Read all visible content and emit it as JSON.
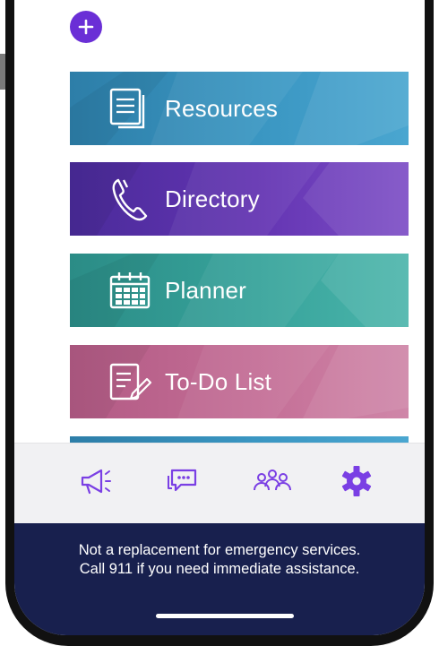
{
  "add_button": {
    "icon": "plus-icon",
    "color": "#6a2fd6"
  },
  "tiles": [
    {
      "label": "Resources",
      "icon": "documents-icon",
      "color": "#3a96c2"
    },
    {
      "label": "Directory",
      "icon": "phone-icon",
      "color": "#6334b2"
    },
    {
      "label": "Planner",
      "icon": "calendar-icon",
      "color": "#37a39b"
    },
    {
      "label": "To-Do List",
      "icon": "checklist-icon",
      "color": "#c46e96"
    }
  ],
  "tabbar": {
    "accent": "#7a3fe4",
    "tabs": [
      {
        "icon": "megaphone-icon"
      },
      {
        "icon": "chat-icon"
      },
      {
        "icon": "people-icon"
      },
      {
        "icon": "gear-icon",
        "active": true
      }
    ]
  },
  "footer": {
    "line1": "Not a replacement for emergency services.",
    "line2": "Call 911 if you need immediate assistance.",
    "background": "#18204e"
  }
}
